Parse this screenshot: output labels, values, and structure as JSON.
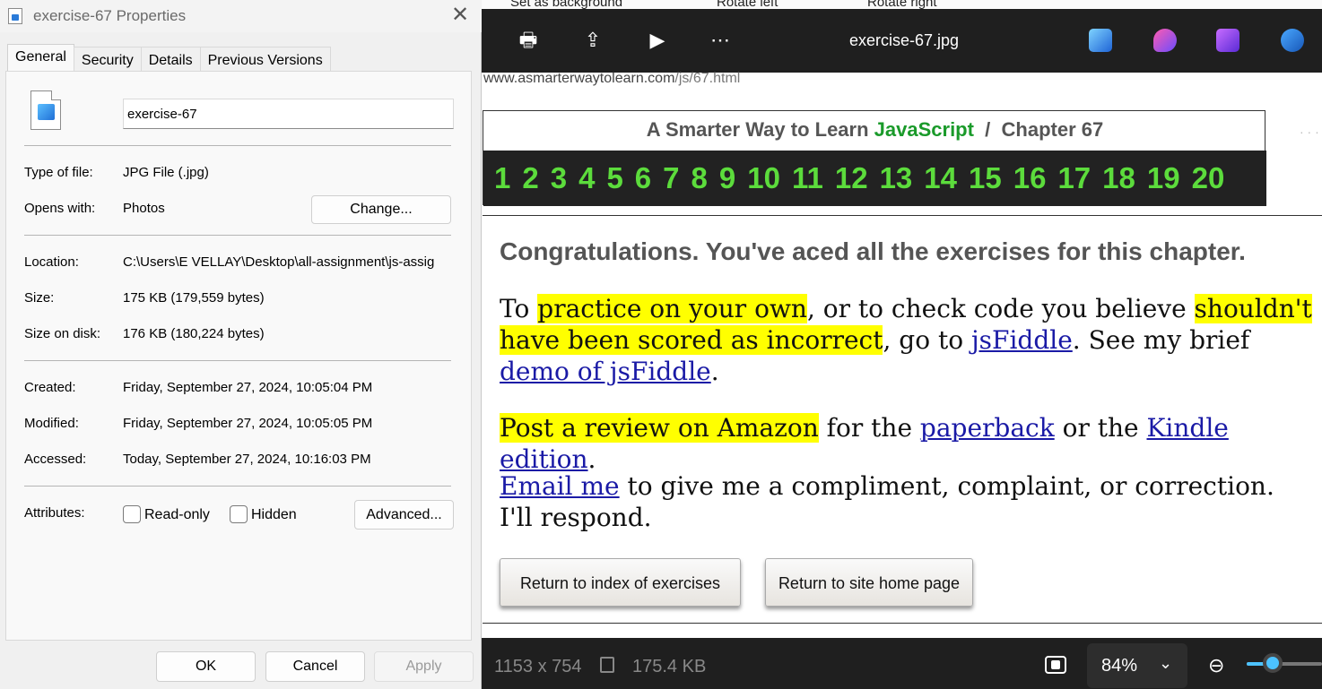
{
  "dialog": {
    "title": "exercise-67 Properties",
    "tabs": [
      "General",
      "Security",
      "Details",
      "Previous Versions"
    ],
    "filename": "exercise-67",
    "type_label": "Type of file:",
    "type_value": "JPG File (.jpg)",
    "opens_label": "Opens with:",
    "opens_value": "Photos",
    "change_button": "Change...",
    "location_label": "Location:",
    "location_value": "C:\\Users\\E VELLAY\\Desktop\\all-assignment\\js-assig",
    "size_label": "Size:",
    "size_value": "175 KB (179,559 bytes)",
    "sizeondisk_label": "Size on disk:",
    "sizeondisk_value": "176 KB (180,224 bytes)",
    "created_label": "Created:",
    "created_value": "Friday, September 27, 2024, 10:05:04 PM",
    "modified_label": "Modified:",
    "modified_value": "Friday, September 27, 2024, 10:05:05 PM",
    "accessed_label": "Accessed:",
    "accessed_value": "Today, September 27, 2024, 10:16:03 PM",
    "attributes_label": "Attributes:",
    "readonly_label": "Read-only",
    "hidden_label": "Hidden",
    "advanced_button": "Advanced...",
    "ok_button": "OK",
    "cancel_button": "Cancel",
    "apply_button": "Apply"
  },
  "viewer": {
    "top_strip": [
      "Set as background",
      "Rotate left",
      "Rotate right"
    ],
    "filename": "exercise-67.jpg",
    "dimensions": "1153 x 754",
    "filesize": "175.4 KB",
    "zoom": "84%",
    "zoom_fraction": 0.35
  },
  "webpage": {
    "url_main": "www.asmarterwaytolearn.com",
    "url_tail": "/js/67.html",
    "header_prefix": "A Smarter Way to Learn ",
    "header_js": "JavaScript",
    "header_suffix": "  /  Chapter 67",
    "chapter_numbers": [
      "1",
      "2",
      "3",
      "4",
      "5",
      "6",
      "7",
      "8",
      "9",
      "10",
      "11",
      "12",
      "13",
      "14",
      "15",
      "16",
      "17",
      "18",
      "19",
      "20"
    ],
    "congrats": "Congratulations. You've aced all the exercises for this chapter.",
    "p1_a": "To ",
    "p1_b": "practice on your own",
    "p1_c": ", or to check code you believe ",
    "p1_d": "shouldn't have been scored as incorrect",
    "p1_e": ", go to ",
    "p1_f": "jsFiddle",
    "p1_g": ". See my brief ",
    "p1_h": "demo of jsFiddle",
    "p1_i": ".",
    "p2_a": "Post a review on Amazon",
    "p2_b": " for the ",
    "p2_c": "paperback",
    "p2_d": " or the ",
    "p2_e": "Kindle edition",
    "p2_f": ".",
    "p3_a": "Email me",
    "p3_b": " to give me a compliment, complaint, or correction. I'll respond.",
    "btn_index": "Return to index of exercises",
    "btn_home": "Return to site home page"
  }
}
